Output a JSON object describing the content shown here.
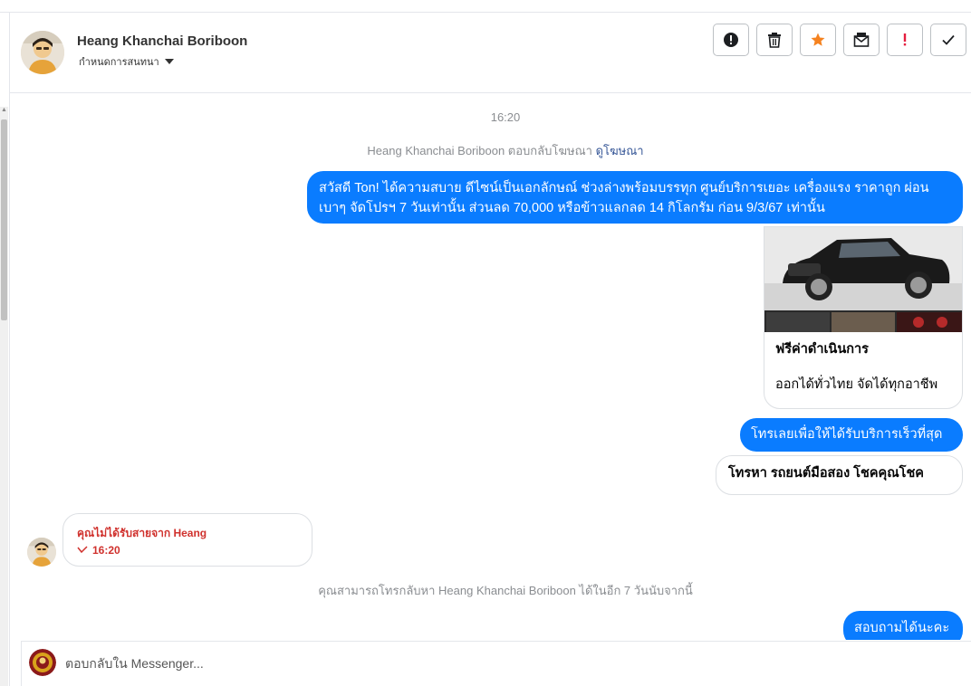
{
  "header": {
    "contact_name": "Heang Khanchai Boriboon",
    "conversation_settings_label": "กำหนดการสนทนา"
  },
  "toolbar": {
    "buttons": [
      {
        "icon": "info-exclamation-icon"
      },
      {
        "icon": "trash-icon"
      },
      {
        "icon": "star-icon",
        "color": "#f5821f"
      },
      {
        "icon": "mark-unread-icon"
      },
      {
        "icon": "spam-exclamation-icon",
        "color": "#e41e3f"
      },
      {
        "icon": "checkmark-icon"
      }
    ]
  },
  "chat": {
    "timestamp": "16:20",
    "ad_reply_text": "Heang Khanchai Boriboon ตอบกลับโฆษณา",
    "ad_reply_link": "ดูโฆษณา",
    "message_1": "สวัสดี Ton! ได้ความสบาย ดีไซน์เป็นเอกลักษณ์ ช่วงล่างพร้อมบรรทุก ศูนย์บริการเยอะ เครื่องแรง ราคาถูก ผ่อนเบาๆ จัดโปรฯ 7 วันเท่านั้น ส่วนลด 70,000 หรือข้าวแลกลด 14 กิโลกรัม ก่อน 9/3/67 เท่านั้น",
    "card": {
      "title": "ฟรีค่าดำเนินการ",
      "subtitle": "ออกได้ทั่วไทย จัดได้ทุกอาชีพ"
    },
    "message_4": "โทรเลยเพื่อให้ได้รับบริการเร็วที่สุด",
    "message_5": "โทรหา รถยนต์มือสอง โชคคุณโชค",
    "missed_call": {
      "text": "คุณไม่ได้รับสายจาก Heang",
      "time": "16:20"
    },
    "callback_note": "คุณสามารถโทรกลับหา Heang Khanchai Boriboon ได้ในอีก 7 วันนับจากนี้",
    "message_6": "สอบถามได้นะคะ"
  },
  "composer": {
    "placeholder": "ตอบกลับใน Messenger..."
  },
  "colors": {
    "outgoing_bubble": "#0a7cff",
    "missed_call_red": "#d0312d",
    "link_blue": "#385898"
  }
}
